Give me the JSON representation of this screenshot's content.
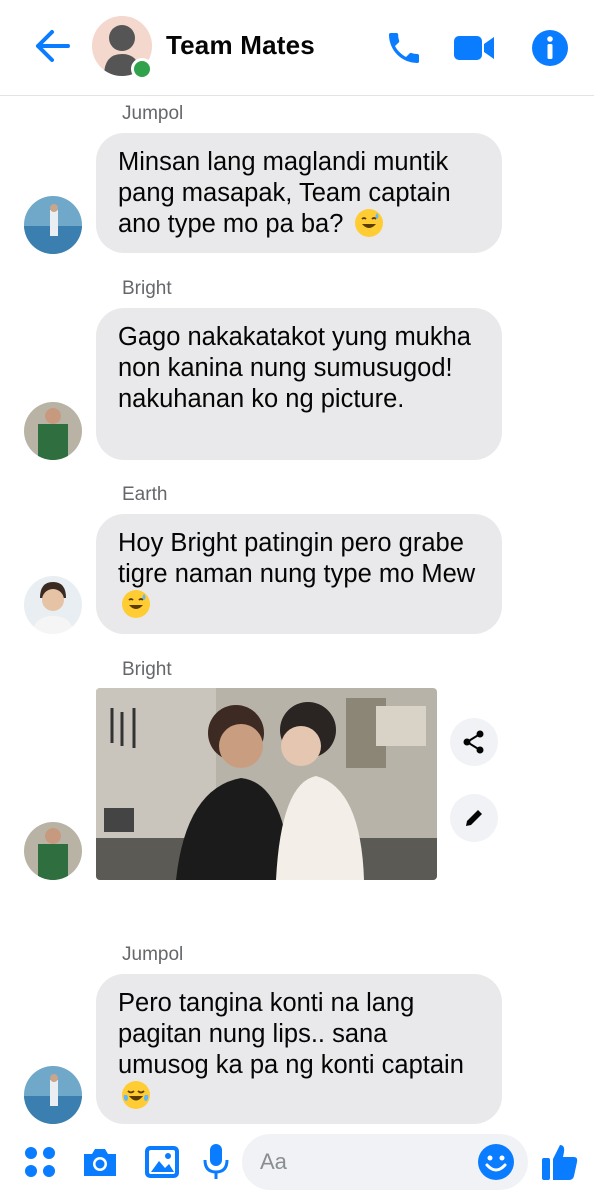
{
  "header": {
    "title": "Team Mates",
    "accent": "#0a7cff"
  },
  "messages": [
    {
      "sender": "Jumpol",
      "text": "Minsan lang maglandi muntik pang masapak, Team captain ano type mo pa ba?"
    },
    {
      "sender": "Bright",
      "text": "Gago nakakatakot yung mukha non kanina nung sumusugod! nakuhanan ko ng picture."
    },
    {
      "sender": "Earth",
      "text": "Hoy Bright patingin pero grabe tigre naman nung type mo Mew"
    },
    {
      "sender": "Bright",
      "image": "photo-two-men-close"
    },
    {
      "sender": "Jumpol",
      "text": "Pero tangina konti na lang pagitan nung lips.. sana umusog ka pa ng konti captain"
    }
  ],
  "composer": {
    "placeholder": "Aa"
  },
  "icons": [
    "back-arrow-icon",
    "phone-icon",
    "video-icon",
    "info-icon",
    "share-icon",
    "edit-icon",
    "apps-icon",
    "camera-icon",
    "image-icon",
    "mic-icon",
    "emoji-icon",
    "like-icon"
  ]
}
